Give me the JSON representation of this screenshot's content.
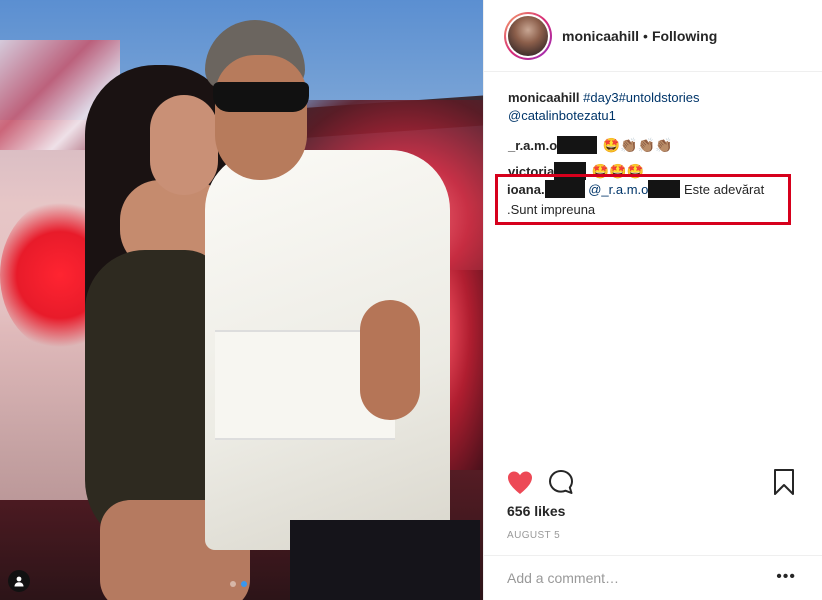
{
  "photo": {
    "carousel_dots": 2,
    "active_dot": 1
  },
  "header": {
    "username": "monicaahill",
    "separator": "•",
    "follow_status": "Following"
  },
  "caption": {
    "username": "monicaahill",
    "hashtags": "#day3#untoldstories",
    "mention": "@catalinbotezatu1"
  },
  "comments": [
    {
      "username": "_r.a.m.o",
      "text": "🤩👏🏽👏🏽👏🏽"
    },
    {
      "username": "victoria",
      "text": "🤩🤩🤩"
    }
  ],
  "highlighted_comment": {
    "username": "ioana.",
    "mention": "@_r.a.m.o",
    "text": "Este adevărat",
    "text2": ".Sunt impreuna"
  },
  "likes": "656 likes",
  "date": "AUGUST 5",
  "comment_input": {
    "placeholder": "Add a comment…"
  },
  "more_glyph": "•••",
  "colors": {
    "heart": "#ed4956",
    "highlight_border": "#d6001c",
    "link": "#003569"
  },
  "icons": [
    "heart-icon",
    "comment-icon",
    "bookmark-icon",
    "user-tag-icon",
    "more-icon"
  ]
}
